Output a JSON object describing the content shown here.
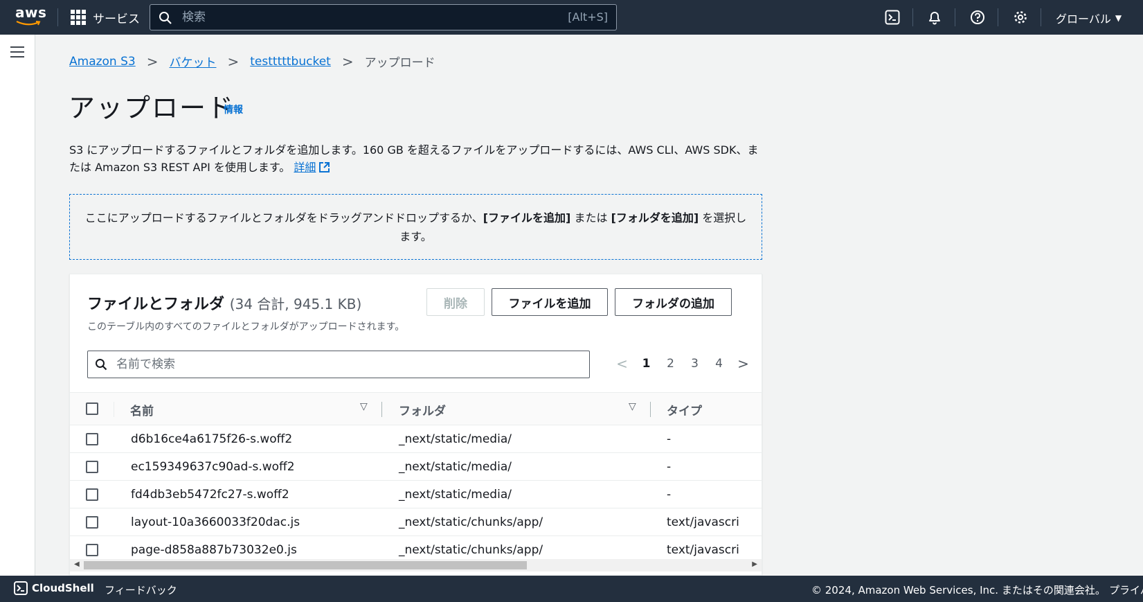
{
  "nav": {
    "logo_text": "aws",
    "services_label": "サービス",
    "search_placeholder": "検索",
    "search_shortcut": "[Alt+S]",
    "region_label": "グローバル",
    "icons": [
      "cloudshell-icon",
      "notifications-bell-icon",
      "help-icon",
      "settings-gear-icon"
    ]
  },
  "breadcrumb": {
    "items": [
      "Amazon S3",
      "バケット",
      "testttttbucket"
    ],
    "current": "アップロード"
  },
  "page": {
    "title": "アップロード",
    "info_link": "情報",
    "description": "S3 にアップロードするファイルとフォルダを追加します。160 GB を超えるファイルをアップロードするには、AWS CLI、AWS SDK、または Amazon S3 REST API を使用します。",
    "description_link": "詳細"
  },
  "dropzone": {
    "text_1": "ここにアップロードするファイルとフォルダをドラッグアンドドロップするか、",
    "bold_1": "[ファイルを追加]",
    "text_2": " または ",
    "bold_2": "[フォルダを追加]",
    "text_3": " を選択します。"
  },
  "files_panel": {
    "title": "ファイルとフォルダ",
    "count": "(34 合計, 945.1 KB)",
    "subtitle": "このテーブル内のすべてのファイルとフォルダがアップロードされます。",
    "buttons": {
      "delete": "削除",
      "add_files": "ファイルを追加",
      "add_folder": "フォルダの追加"
    },
    "filter_placeholder": "名前で検索",
    "pagination": {
      "pages": [
        "1",
        "2",
        "3",
        "4"
      ],
      "current": "1"
    },
    "columns": [
      "名前",
      "フォルダ",
      "タイプ"
    ],
    "rows": [
      {
        "name": "d6b16ce4a6175f26-s.woff2",
        "folder": "_next/static/media/",
        "type": "-"
      },
      {
        "name": "ec159349637c90ad-s.woff2",
        "folder": "_next/static/media/",
        "type": "-"
      },
      {
        "name": "fd4db3eb5472fc27-s.woff2",
        "folder": "_next/static/media/",
        "type": "-"
      },
      {
        "name": "layout-10a3660033f20dac.js",
        "folder": "_next/static/chunks/app/",
        "type": "text/javascri"
      },
      {
        "name": "page-d858a887b73032e0.js",
        "folder": "_next/static/chunks/app/",
        "type": "text/javascri"
      }
    ]
  },
  "footer": {
    "cloudshell": "CloudShell",
    "feedback": "フィードバック",
    "copyright": "© 2024, Amazon Web Services, Inc. またはその関連会社。",
    "privacy": "プライバ"
  },
  "colors": {
    "nav_bg": "#232f3e",
    "link": "#0972d3",
    "page_bg": "#f2f3f3"
  }
}
